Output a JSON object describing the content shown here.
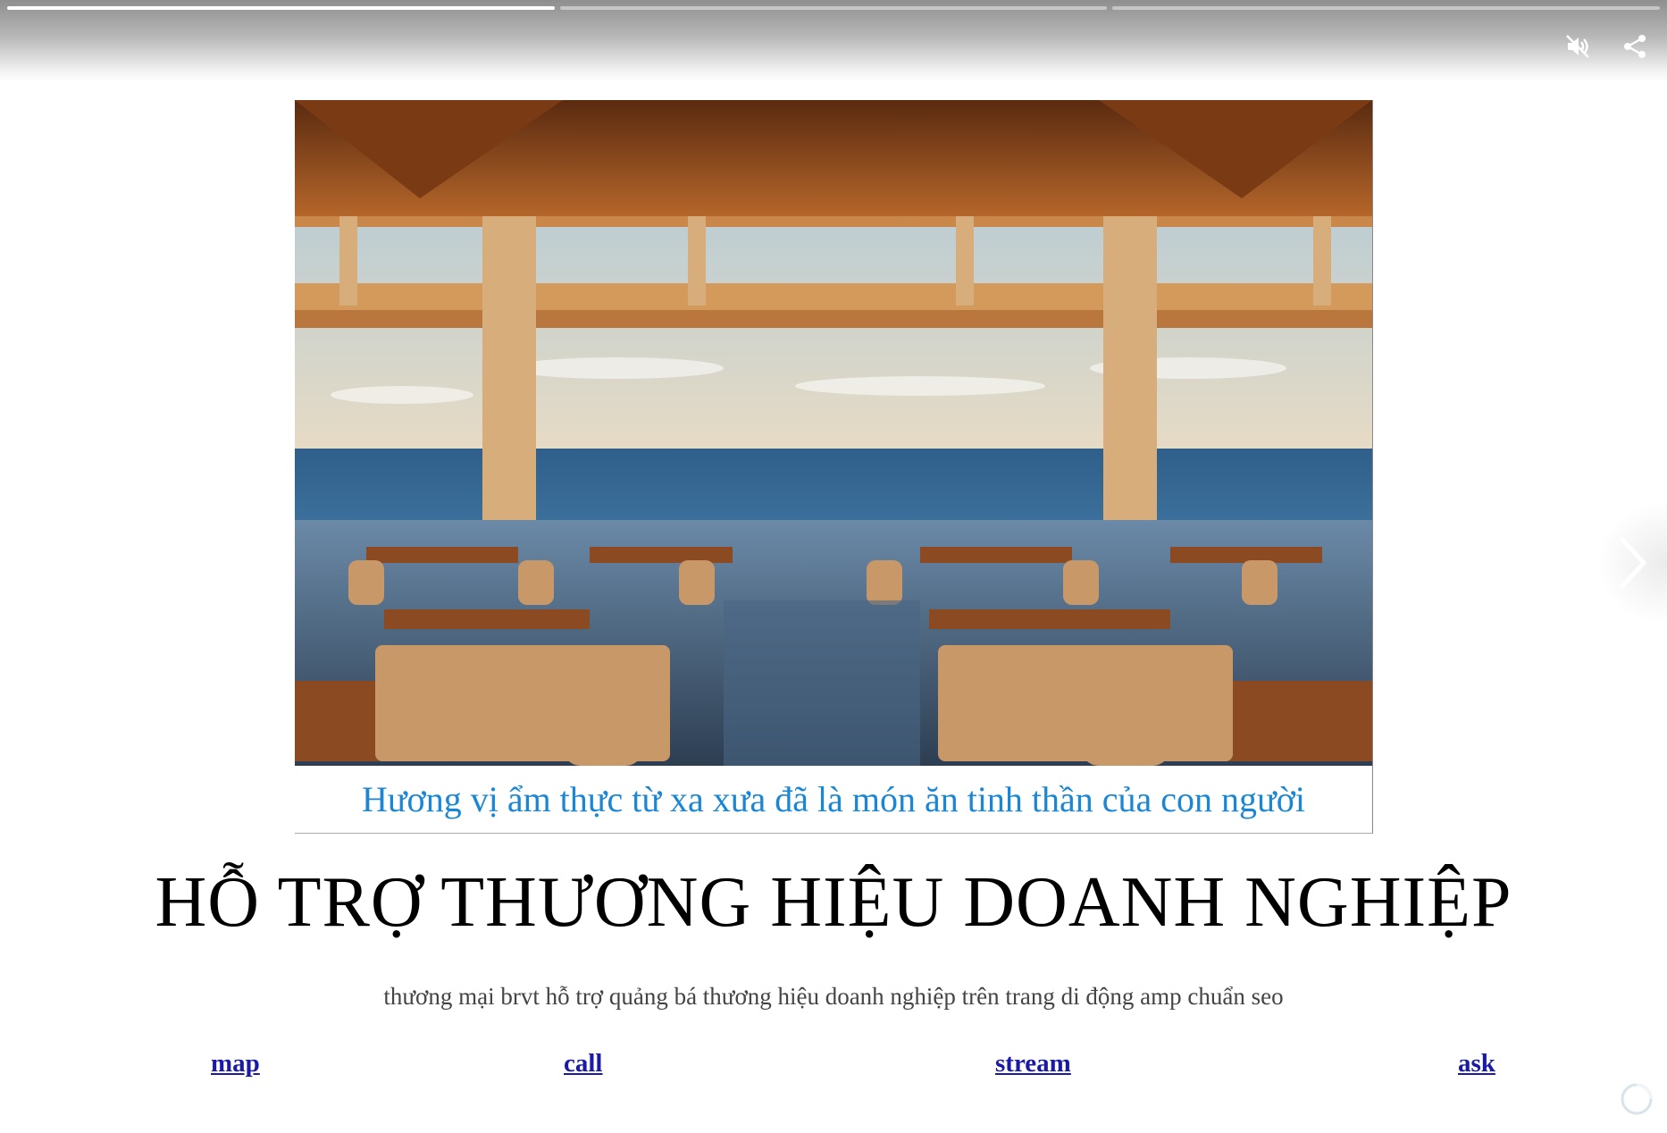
{
  "story": {
    "progress": [
      1.0,
      0.0,
      0.0
    ],
    "icons": {
      "mute": "volume-off-icon",
      "share": "share-icon",
      "next": "chevron-right-icon",
      "loader": "loading-spinner-icon"
    }
  },
  "hero": {
    "caption": "Hương vị ẩm thực từ xa xưa đã là món ăn tinh thần của con người",
    "caption_color": "#1a86d4"
  },
  "title": "HỖ TRỢ THƯƠNG HIỆU DOANH NGHIỆP",
  "subtitle": "thương mại brvt hỗ trợ quảng bá thương hiệu doanh nghiệp trên trang di động amp chuẩn seo",
  "links": {
    "map": "map",
    "call": "call",
    "stream": "stream",
    "ask": "ask"
  },
  "colors": {
    "link": "#1a1aa6",
    "title": "#000000"
  }
}
